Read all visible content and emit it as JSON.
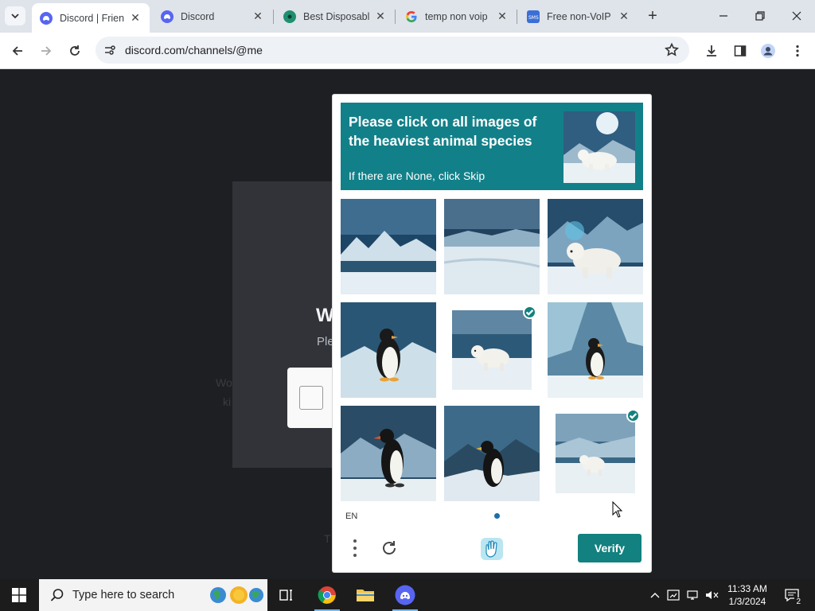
{
  "browser": {
    "tabs": [
      {
        "title": "Discord | Friends",
        "favicon": "discord-icon",
        "active": true
      },
      {
        "title": "Discord",
        "favicon": "discord-icon",
        "active": false
      },
      {
        "title": "Best Disposable",
        "favicon": "generic-site-icon",
        "active": false
      },
      {
        "title": "temp non voip",
        "favicon": "google-icon",
        "active": false
      },
      {
        "title": "Free non-VoIP",
        "favicon": "sms-icon",
        "active": false
      }
    ],
    "url": "discord.com/channels/@me",
    "colors": {
      "tabstrip": "#dfe3ea",
      "omnibox": "#eef1f6"
    }
  },
  "page_background": {
    "heading_partial": "W",
    "subtitle_partial": "Ple",
    "faint_left_1": "Wo",
    "faint_left_2": "ki",
    "faint_bottom": "T"
  },
  "captcha": {
    "prompt": "Please click on all images of the heaviest animal species",
    "hint": "If there are None, click Skip",
    "language": "EN",
    "verify_label": "Verify",
    "accent_color": "#12817f",
    "images": [
      {
        "subject": "icy mountains",
        "selected": false
      },
      {
        "subject": "snowy plain",
        "selected": false
      },
      {
        "subject": "polar bear",
        "selected": false
      },
      {
        "subject": "penguin",
        "selected": false
      },
      {
        "subject": "polar bear cub",
        "selected": true
      },
      {
        "subject": "penguin",
        "selected": false
      },
      {
        "subject": "penguin",
        "selected": false
      },
      {
        "subject": "penguin",
        "selected": false
      },
      {
        "subject": "polar bear",
        "selected": true
      }
    ]
  },
  "taskbar": {
    "search_placeholder": "Type here to search",
    "time": "11:33 AM",
    "date": "1/3/2024",
    "notification_count": "2"
  }
}
